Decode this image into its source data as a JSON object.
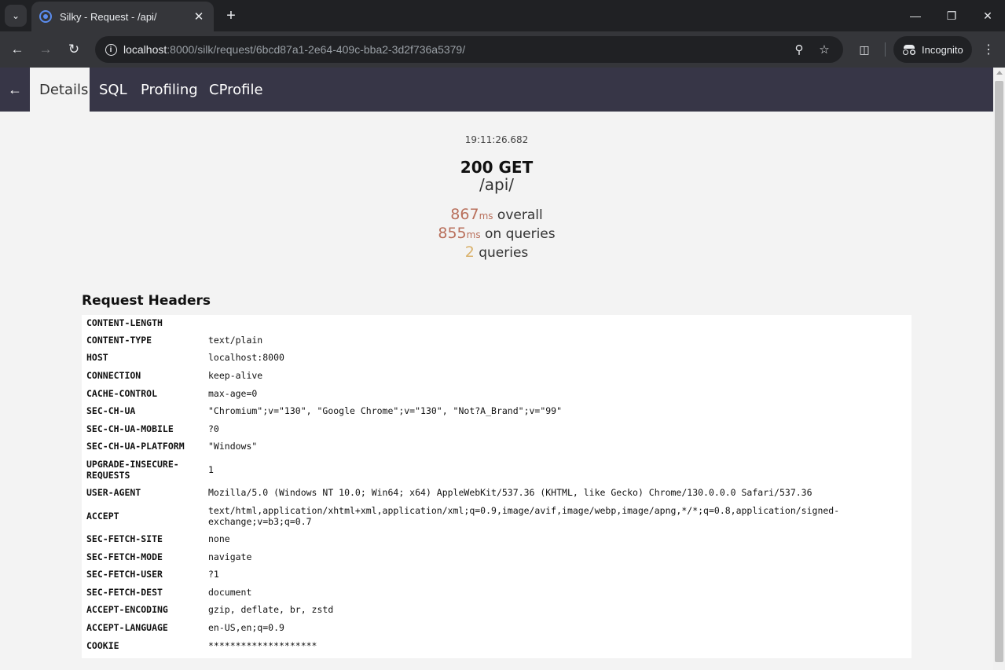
{
  "browser": {
    "tab_title": "Silky - Request - /api/",
    "url_host": "localhost",
    "url_rest": ":8000/silk/request/6bcd87a1-2e64-409c-bba2-3d2f736a5379/",
    "profile_label": "Incognito",
    "icons": [
      "tab-search-icon",
      "favicon-icon",
      "close-icon",
      "plus-icon",
      "minimize-icon",
      "restore-icon",
      "window-close-icon",
      "back-icon",
      "forward-icon",
      "reload-icon",
      "site-info-icon",
      "zoom-icon",
      "star-icon",
      "extensions-icon",
      "incognito-icon",
      "menu-icon"
    ]
  },
  "silk_nav": {
    "tabs": [
      {
        "label": "Details",
        "active": true
      },
      {
        "label": "SQL"
      },
      {
        "label": "Profiling"
      },
      {
        "label": "CProfile"
      }
    ]
  },
  "summary": {
    "time": "19:11:26.682",
    "status_method": "200 GET",
    "path": "/api/",
    "overall_value": "867",
    "overall_unit": "ms",
    "overall_label": "overall",
    "queries_time_value": "855",
    "queries_time_unit": "ms",
    "queries_time_label": "on queries",
    "query_count": "2",
    "query_count_label": "queries"
  },
  "request_headers": {
    "title": "Request Headers",
    "rows": [
      {
        "key": "CONTENT-LENGTH",
        "value": ""
      },
      {
        "key": "CONTENT-TYPE",
        "value": "text/plain"
      },
      {
        "key": "HOST",
        "value": "localhost:8000"
      },
      {
        "key": "CONNECTION",
        "value": "keep-alive"
      },
      {
        "key": "CACHE-CONTROL",
        "value": "max-age=0"
      },
      {
        "key": "SEC-CH-UA",
        "value": "\"Chromium\";v=\"130\", \"Google Chrome\";v=\"130\", \"Not?A_Brand\";v=\"99\""
      },
      {
        "key": "SEC-CH-UA-MOBILE",
        "value": "?0"
      },
      {
        "key": "SEC-CH-UA-PLATFORM",
        "value": "\"Windows\""
      },
      {
        "key": "UPGRADE-INSECURE-REQUESTS",
        "value": "1"
      },
      {
        "key": "USER-AGENT",
        "value": "Mozilla/5.0 (Windows NT 10.0; Win64; x64) AppleWebKit/537.36 (KHTML, like Gecko) Chrome/130.0.0.0 Safari/537.36"
      },
      {
        "key": "ACCEPT",
        "value": "text/html,application/xhtml+xml,application/xml;q=0.9,image/avif,image/webp,image/apng,*/*;q=0.8,application/signed-exchange;v=b3;q=0.7"
      },
      {
        "key": "SEC-FETCH-SITE",
        "value": "none"
      },
      {
        "key": "SEC-FETCH-MODE",
        "value": "navigate"
      },
      {
        "key": "SEC-FETCH-USER",
        "value": "?1"
      },
      {
        "key": "SEC-FETCH-DEST",
        "value": "document"
      },
      {
        "key": "ACCEPT-ENCODING",
        "value": "gzip, deflate, br, zstd"
      },
      {
        "key": "ACCEPT-LANGUAGE",
        "value": "en-US,en;q=0.9"
      },
      {
        "key": "COOKIE",
        "value": "********************"
      }
    ]
  }
}
